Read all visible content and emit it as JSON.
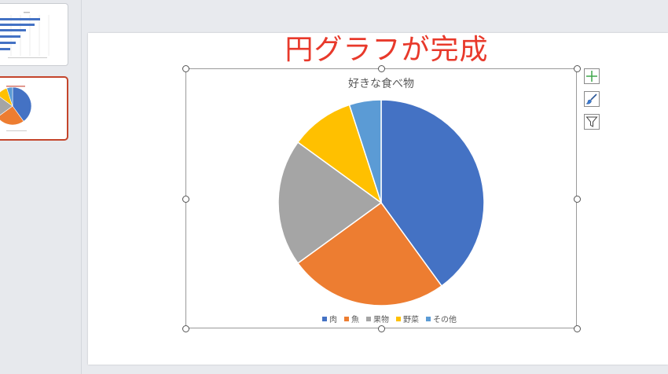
{
  "slide": {
    "title": "円グラフが完成"
  },
  "thumbnails": [
    {
      "index": 1,
      "kind": "bar-chart-slide",
      "selected": false
    },
    {
      "index": 2,
      "kind": "pie-chart-slide",
      "selected": true
    }
  ],
  "chart_tools": {
    "elements_button": "chart-elements",
    "styles_button": "chart-styles",
    "filter_button": "chart-filters"
  },
  "colors": {
    "accent_title": "#e8392b",
    "selected_thumb_border": "#c4452b",
    "plus_icon": "#3fa74a"
  },
  "chart_data": {
    "type": "pie",
    "title": "好きな食べ物",
    "categories": [
      "肉",
      "魚",
      "果物",
      "野菜",
      "その他"
    ],
    "values": [
      40,
      25,
      20,
      10,
      5
    ],
    "colors": [
      "#4472c4",
      "#ed7d31",
      "#a5a5a5",
      "#ffc000",
      "#5b9bd5"
    ],
    "legend_position": "bottom"
  }
}
